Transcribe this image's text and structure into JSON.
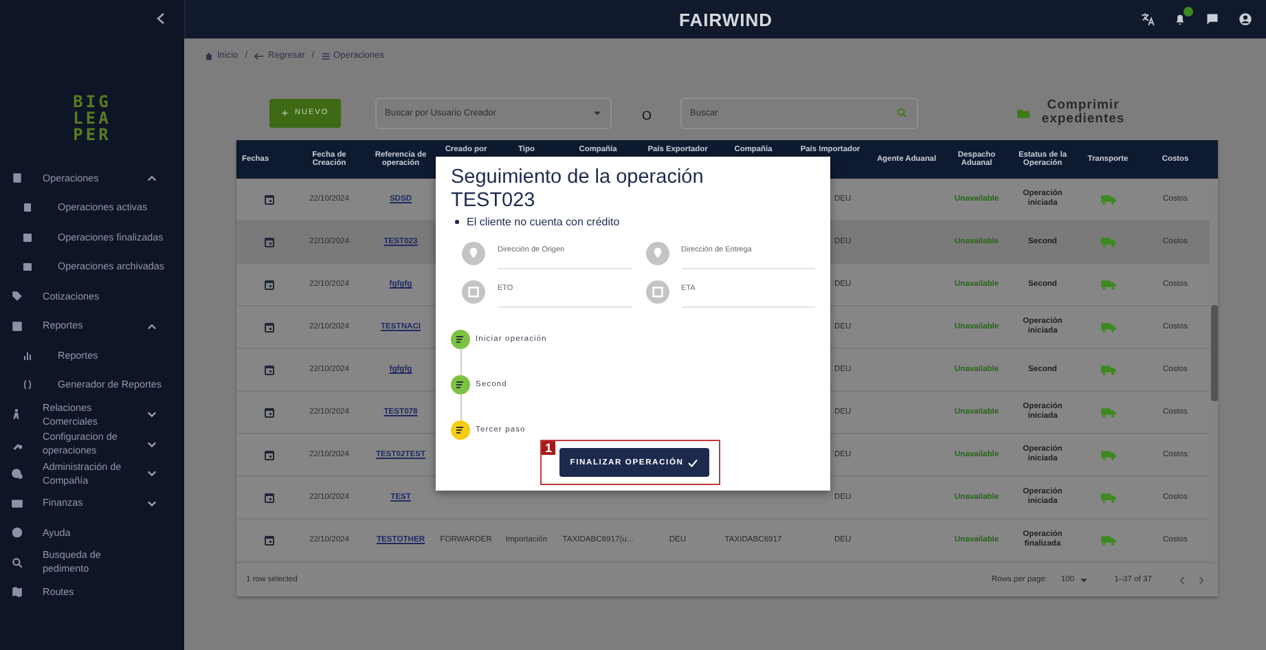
{
  "sidebar": {
    "logo": [
      "BIG",
      "LEA",
      "PER"
    ],
    "items": [
      {
        "label": "Operaciones",
        "kind": "group",
        "expanded": true,
        "children": [
          {
            "label": "Operaciones activas"
          },
          {
            "label": "Operaciones finalizadas"
          },
          {
            "label": "Operaciones archivadas"
          }
        ]
      },
      {
        "label": "Cotizaciones",
        "kind": "link"
      },
      {
        "label": "Reportes",
        "kind": "group",
        "expanded": true,
        "children": [
          {
            "label": "Reportes"
          },
          {
            "label": "Generador de Reportes"
          }
        ]
      },
      {
        "label": "Relaciones Comerciales",
        "kind": "group",
        "expanded": false
      },
      {
        "label": "Configuracion de operaciones",
        "kind": "group",
        "expanded": false
      },
      {
        "label": "Administración de Compañía",
        "kind": "group",
        "expanded": false
      },
      {
        "label": "Finanzas",
        "kind": "group",
        "expanded": false
      },
      {
        "label": "Ayuda",
        "kind": "link"
      },
      {
        "label": "Busqueda de pedimento",
        "kind": "link"
      },
      {
        "label": "Routes",
        "kind": "link"
      }
    ]
  },
  "topbar": {
    "title": "FAIRWIND"
  },
  "breadcrumb": [
    "Inicio",
    "Regresar",
    "Operaciones"
  ],
  "breadcrumb_separators": [
    "/",
    "/"
  ],
  "toolbar": {
    "new_button_icon": "+",
    "new_button": "NUEVO",
    "user_select": {
      "placeholder": "Buscar por Usuario Creador"
    },
    "or_label": "O",
    "search": {
      "placeholder": "Buscar"
    },
    "compress_button": "Comprimir expedientes"
  },
  "table": {
    "columns": [
      "Fechas",
      "Fecha de Creación",
      "Referencia de operación",
      "Creado por",
      "Tipo",
      "Compañía",
      "País Exportador",
      "Compañía",
      "País Importador",
      "Agente Aduanal",
      "Despacho Aduanal",
      "Estatus de la Operación",
      "Transporte",
      "Costos"
    ],
    "rows": [
      {
        "selected": false,
        "date": "22/10/2024",
        "ref": "SDSD",
        "importer_country": "DEU",
        "customs": "Unavailable",
        "status": "Operación iniciada",
        "costs": "Costos"
      },
      {
        "selected": true,
        "date": "22/10/2024",
        "ref": "TEST023",
        "importer_country": "DEU",
        "customs": "Unavailable",
        "status": "Second",
        "costs": "Costos"
      },
      {
        "selected": false,
        "date": "22/10/2024",
        "ref": "fgfgfg",
        "importer_country": "DEU",
        "customs": "Unavailable",
        "status": "Second",
        "costs": "Costos"
      },
      {
        "selected": false,
        "date": "22/10/2024",
        "ref": "TESTNACI",
        "importer_country": "DEU",
        "customs": "Unavailable",
        "status": "Operación iniciada",
        "costs": "Costos"
      },
      {
        "selected": false,
        "date": "22/10/2024",
        "ref": "fgfgfg",
        "importer_country": "DEU",
        "customs": "Unavailable",
        "status": "Second",
        "costs": "Costos"
      },
      {
        "selected": false,
        "date": "22/10/2024",
        "ref": "TEST078",
        "importer_country": "DEU",
        "customs": "Unavailable",
        "status": "Operación iniciada",
        "costs": "Costos"
      },
      {
        "selected": false,
        "date": "22/10/2024",
        "ref": "TEST02TEST",
        "importer_country": "DEU",
        "customs": "Unavailable",
        "status": "Operación iniciada",
        "costs": "Costos"
      },
      {
        "selected": false,
        "date": "22/10/2024",
        "ref": "TEST",
        "importer_country": "DEU",
        "customs": "Unavailable",
        "status": "Operación iniciada",
        "costs": "Costos"
      },
      {
        "selected": false,
        "date": "22/10/2024",
        "ref": "TESTOTHER",
        "created_by": "FORWARDER",
        "type": "Importación",
        "exporter_company": "TAXIDABC6917(u...",
        "exporter_country": "DEU",
        "importer_company": "TAXIDABC6917",
        "importer_country": "DEU",
        "customs": "Unavailable",
        "status": "Operación finalizada",
        "costs": "Costos"
      }
    ],
    "footer": {
      "selection": "1 row selected",
      "rows_per_page_label": "Rows per page:",
      "rows_per_page": "100",
      "range": "1–37 of 37"
    }
  },
  "modal": {
    "title": "Seguimiento de la operación",
    "subtitle": "TEST023",
    "notes": [
      "El cliente no cuenta con crédito"
    ],
    "fields": [
      {
        "label": "Dirección de Origen"
      },
      {
        "label": "Dirección de Entrega"
      },
      {
        "label": "ETO"
      },
      {
        "label": "ETA"
      }
    ],
    "steps": [
      {
        "label": "Iniciar operación",
        "color": "#7cc242"
      },
      {
        "label": "Second",
        "color": "#7cc242"
      },
      {
        "label": "Tercer paso",
        "color": "#f5cc12"
      }
    ],
    "finish_button": "FINALIZAR OPERACIÓN",
    "annotation": "1"
  }
}
